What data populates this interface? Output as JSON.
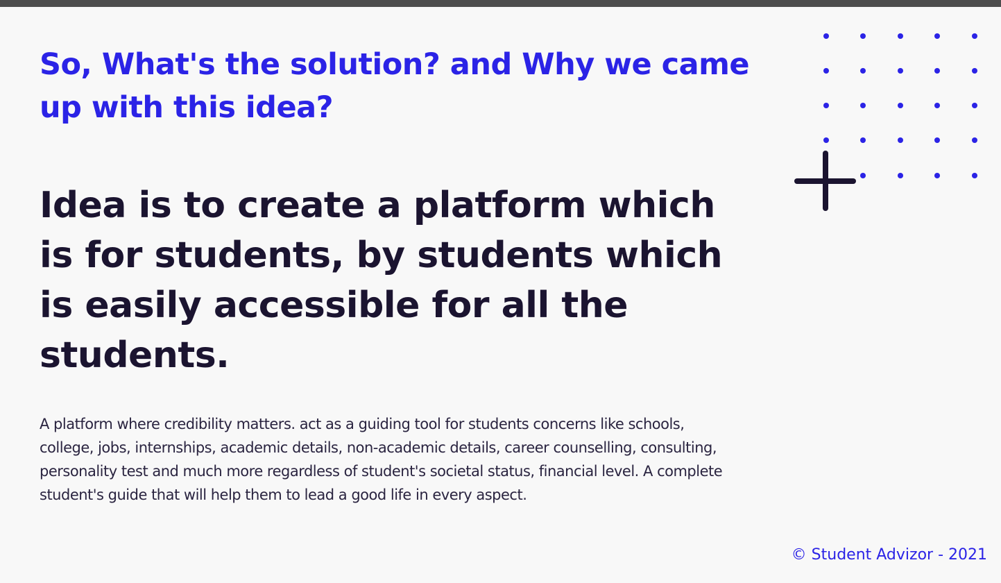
{
  "section": {
    "subtitle": "So, What's the solution? and Why we came up with this idea?",
    "headline": "Idea is to create a platform which is for students, by students which is easily accessible for all the students.",
    "body": "A platform where credibility matters. act as a guiding tool for students concerns like schools, college, jobs, internships, academic details, non-academic details, career counselling, consulting, personality test and much more regardless of student's societal status, financial level. A complete student's guide that will help them to lead a good life in every aspect."
  },
  "decor": {
    "dot_color": "#2b23e6",
    "plus_color": "#1b1430",
    "icons": [
      "dot-grid-icon",
      "plus-icon"
    ]
  },
  "footer": {
    "copyright": "© Student Advizor - 2021"
  },
  "colors": {
    "accent": "#2b23e6",
    "heading": "#1b1430",
    "text": "#2a2440",
    "background": "#f8f8f8"
  }
}
